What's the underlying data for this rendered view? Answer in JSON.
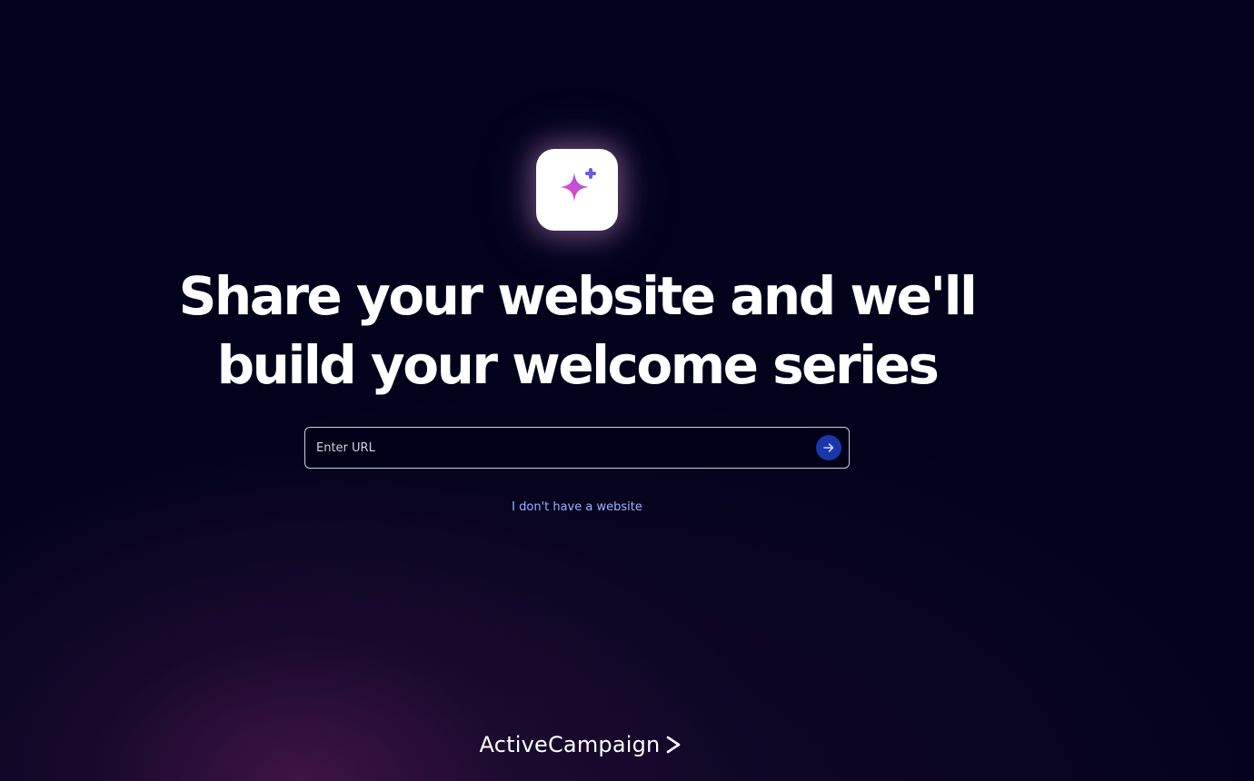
{
  "hero": {
    "icon": "sparkle-icon",
    "headline": "Share your website and we'll build your welcome series"
  },
  "url_form": {
    "placeholder": "Enter URL",
    "value": "",
    "submit_icon": "arrow-right-icon"
  },
  "no_website_link": "I don't have a website",
  "footer": {
    "brand_name": "ActiveCampaign",
    "brand_icon": "chevron-right-icon"
  },
  "colors": {
    "background": "#02021c",
    "glow": "#461648",
    "submit_button": "#1b36a8",
    "link": "#9db3ff",
    "sparkle_gradient_start": "#ee4fa8",
    "sparkle_gradient_end": "#6a5be8"
  }
}
